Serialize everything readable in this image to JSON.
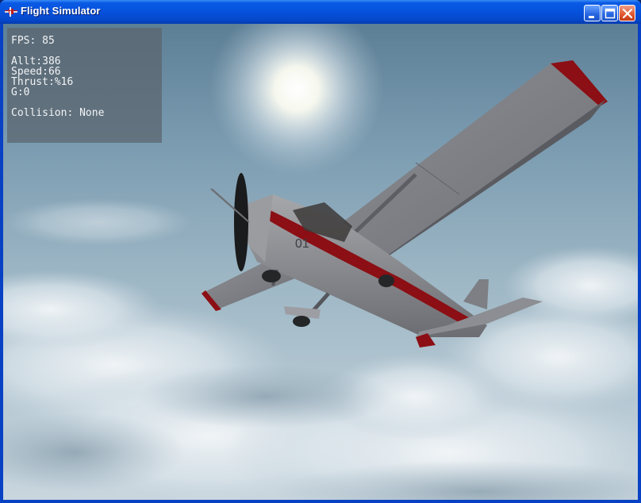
{
  "window": {
    "title": "Flight Simulator",
    "icon": "airplane-app-icon",
    "controls": [
      "minimize-icon",
      "maximize-icon",
      "close-icon"
    ]
  },
  "hud": {
    "fps": "FPS: 85",
    "altitude": "Allt:386",
    "speed": "Speed:66",
    "thrust": "Thrust:%16",
    "g": "G:0",
    "collision": "Collision: None"
  },
  "aircraft": {
    "registration": "01",
    "livery_colors": {
      "body": "#8a8a8e",
      "stripe": "#8b0f14"
    }
  },
  "colors": {
    "titlebar": "#0652dc",
    "sky": "#6f93a8",
    "cloud": "#e6ecf0"
  }
}
